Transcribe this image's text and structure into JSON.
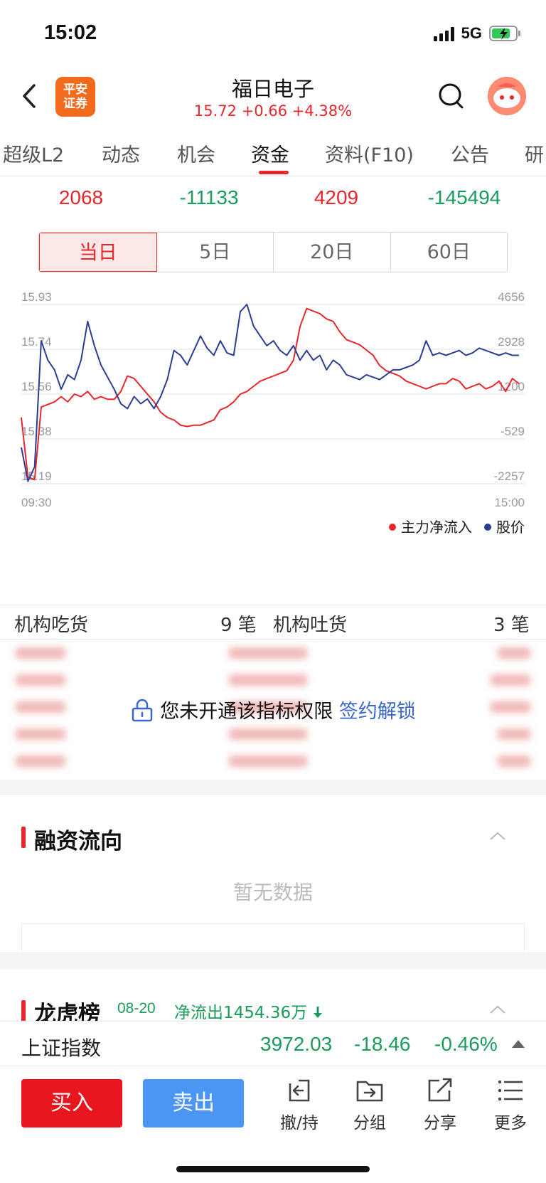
{
  "status_bar": {
    "time": "15:02",
    "network": "5G"
  },
  "header": {
    "brand_logo_text": "平安证券",
    "stock_name": "福日电子",
    "quote": "15.72 +0.66 +4.38%"
  },
  "tabs": [
    {
      "label": "超级L2"
    },
    {
      "label": "动态"
    },
    {
      "label": "机会"
    },
    {
      "label": "资金"
    },
    {
      "label": "资料(F10)"
    },
    {
      "label": "公告"
    },
    {
      "label": "研"
    }
  ],
  "active_tab": "资金",
  "flow_values": [
    "2068",
    "-11133",
    "4209",
    "-145494"
  ],
  "periods": [
    "当日",
    "5日",
    "20日",
    "60日"
  ],
  "active_period": "当日",
  "chart_data": {
    "type": "line",
    "x_start": "09:30",
    "x_end": "15:00",
    "price_axis_ticks": [
      "15.93",
      "15.74",
      "15.56",
      "15.38",
      "15.19"
    ],
    "flow_axis_ticks": [
      "4656",
      "2928",
      "1200",
      "-529",
      "-2257"
    ],
    "price_ylim": [
      15.19,
      15.93
    ],
    "flow_ylim": [
      -2257,
      4656
    ],
    "grid": true,
    "legend_position": "bottom-right",
    "series": [
      {
        "name": "主力净流入",
        "color": "#e8262b",
        "axis": "right",
        "values": [
          300,
          -2000,
          -2100,
          700,
          800,
          900,
          1100,
          900,
          1200,
          1100,
          1300,
          1000,
          1100,
          1000,
          1000,
          1300,
          1900,
          1800,
          1500,
          1200,
          900,
          500,
          300,
          200,
          0,
          -50,
          0,
          0,
          100,
          200,
          600,
          700,
          900,
          1200,
          1300,
          1500,
          1700,
          1800,
          1900,
          2000,
          2100,
          2500,
          3800,
          4500,
          4400,
          4300,
          4100,
          4000,
          3600,
          3300,
          3200,
          3100,
          2900,
          2700,
          2300,
          2100,
          2000,
          1900,
          1700,
          1600,
          1500,
          1400,
          1500,
          1600,
          1600,
          1800,
          1700,
          1400,
          1500,
          1600,
          1400,
          1500,
          1700,
          1300,
          1800,
          1600
        ]
      },
      {
        "name": "股价",
        "color": "#2c3e94",
        "axis": "left",
        "values": [
          15.34,
          15.2,
          15.26,
          15.78,
          15.7,
          15.66,
          15.58,
          15.64,
          15.62,
          15.7,
          15.86,
          15.76,
          15.68,
          15.63,
          15.58,
          15.52,
          15.5,
          15.55,
          15.52,
          15.54,
          15.5,
          15.55,
          15.62,
          15.74,
          15.72,
          15.68,
          15.74,
          15.8,
          15.75,
          15.72,
          15.78,
          15.73,
          15.72,
          15.9,
          15.93,
          15.84,
          15.8,
          15.76,
          15.78,
          15.74,
          15.72,
          15.76,
          15.7,
          15.74,
          15.7,
          15.72,
          15.66,
          15.7,
          15.68,
          15.64,
          15.63,
          15.62,
          15.64,
          15.63,
          15.62,
          15.64,
          15.66,
          15.66,
          15.67,
          15.68,
          15.7,
          15.78,
          15.72,
          15.73,
          15.72,
          15.73,
          15.74,
          15.72,
          15.73,
          15.75,
          15.74,
          15.73,
          15.72,
          15.73,
          15.72,
          15.72
        ]
      }
    ]
  },
  "institution": {
    "buy_label": "机构吃货",
    "buy_count": "9 笔",
    "sell_label": "机构吐货",
    "sell_count": "3 笔",
    "locked_message": "您未开通该指标权限",
    "unlock_link": "签约解锁"
  },
  "margin_section": {
    "title": "融资流向",
    "empty_text": "暂无数据"
  },
  "lhb_section": {
    "title": "龙虎榜",
    "date": "08-20",
    "net_text": "净流出1454.36万"
  },
  "index_bar": {
    "name": "上证指数",
    "value": "3972.03",
    "change": "-18.46",
    "pct": "-0.46%"
  },
  "bottom_actions": {
    "buy": "买入",
    "sell": "卖出",
    "tools": [
      "撤/持",
      "分组",
      "分享",
      "更多"
    ]
  }
}
